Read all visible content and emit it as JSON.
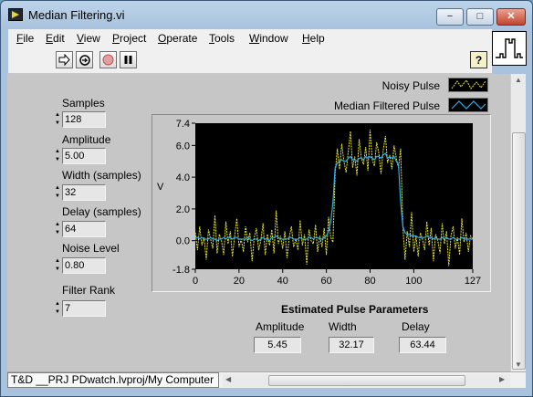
{
  "window": {
    "title": "Median Filtering.vi",
    "buttons": [
      "−",
      "□",
      "✕"
    ]
  },
  "menu": [
    {
      "label": "File",
      "key": "F",
      "rest": "ile"
    },
    {
      "label": "Edit",
      "key": "E",
      "rest": "dit"
    },
    {
      "label": "View",
      "key": "V",
      "rest": "iew"
    },
    {
      "label": "Project",
      "key": "P",
      "rest": "roject"
    },
    {
      "label": "Operate",
      "key": "O",
      "rest": "perate"
    },
    {
      "label": "Tools",
      "key": "T",
      "rest": "ools"
    },
    {
      "label": "Window",
      "key": "W",
      "rest": "indow"
    },
    {
      "label": "Help",
      "key": "H",
      "rest": "elp"
    }
  ],
  "toolbar": {
    "run_icon": "run-arrow-icon",
    "run_continuous_icon": "run-continuously-icon",
    "abort_icon": "abort-stop-icon",
    "pause_icon": "pause-icon",
    "help_label": "?"
  },
  "controls": {
    "samples": {
      "label": "Samples",
      "value": "128"
    },
    "amplitude": {
      "label": "Amplitude",
      "value": "5.00"
    },
    "width": {
      "label": "Width (samples)",
      "value": "32"
    },
    "delay": {
      "label": "Delay (samples)",
      "value": "64"
    },
    "noise": {
      "label": "Noise Level",
      "value": "0.80"
    },
    "rank": {
      "label": "Filter Rank",
      "value": "7"
    }
  },
  "legend": {
    "noisy": {
      "name": "Noisy Pulse",
      "color": "#e8e830"
    },
    "filtered": {
      "name": "Median Filtered Pulse",
      "color": "#2bb0e8"
    }
  },
  "estimated": {
    "title": "Estimated Pulse Parameters",
    "amplitude": {
      "label": "Amplitude",
      "value": "5.45"
    },
    "width": {
      "label": "Width",
      "value": "32.17"
    },
    "delay": {
      "label": "Delay",
      "value": "63.44"
    }
  },
  "status": {
    "project_path": "T&D __PRJ PDwatch.lvproj/My Computer"
  },
  "chart_data": {
    "type": "line",
    "title": "",
    "xlabel": "",
    "ylabel": "V",
    "xlim": [
      0,
      127
    ],
    "ylim": [
      -1.8,
      7.4
    ],
    "x_ticks": [
      0,
      20,
      40,
      60,
      80,
      100,
      127
    ],
    "y_ticks": [
      -1.8,
      0.0,
      2.0,
      4.0,
      6.0,
      7.4
    ],
    "y_tick_labels": [
      "-1.8",
      "0.0",
      "2.0",
      "4.0",
      "6.0",
      "7.4"
    ],
    "background": "#000000",
    "series": [
      {
        "name": "Noisy Pulse",
        "color": "#e8e830",
        "values": [
          0.5,
          -0.6,
          0.9,
          -0.3,
          0.2,
          -1.2,
          0.7,
          0.1,
          -0.5,
          1.6,
          -0.8,
          0.4,
          0.0,
          -0.9,
          1.2,
          -0.2,
          0.6,
          -1.0,
          0.3,
          1.4,
          -0.4,
          0.1,
          -0.7,
          0.9,
          -0.1,
          0.5,
          -1.3,
          0.2,
          0.8,
          -0.6,
          0.0,
          1.1,
          -0.9,
          0.4,
          -0.3,
          0.7,
          -0.8,
          1.9,
          -0.2,
          0.3,
          -0.5,
          0.6,
          -1.1,
          0.2,
          0.9,
          -0.4,
          0.1,
          -0.6,
          1.3,
          -0.3,
          0.4,
          -1.5,
          0.7,
          0.0,
          -0.2,
          1.0,
          -0.7,
          0.3,
          -0.4,
          0.8,
          -0.9,
          1.5,
          0.2,
          -0.1,
          4.2,
          5.8,
          4.5,
          6.1,
          5.0,
          4.3,
          5.6,
          6.9,
          4.6,
          5.3,
          4.1,
          6.4,
          5.2,
          4.8,
          5.9,
          4.4,
          7.0,
          5.1,
          4.7,
          6.2,
          5.5,
          4.2,
          5.7,
          6.6,
          4.9,
          5.4,
          4.5,
          6.0,
          5.2,
          4.6,
          5.8,
          0.9,
          -1.2,
          0.6,
          -0.4,
          1.8,
          -0.7,
          0.3,
          -1.0,
          0.5,
          0.1,
          -0.6,
          1.2,
          -0.3,
          0.8,
          -1.3,
          0.4,
          0.0,
          -0.8,
          1.1,
          -0.2,
          0.6,
          -1.6,
          0.3,
          0.9,
          -0.5,
          0.2,
          -0.9,
          1.4,
          -0.1,
          0.5,
          -0.7,
          0.3,
          0.1
        ]
      },
      {
        "name": "Median Filtered Pulse",
        "color": "#2bb0e8",
        "values": [
          0.2,
          0.2,
          0.1,
          0.2,
          0.1,
          0.1,
          0.1,
          0.2,
          0.1,
          0.1,
          0.0,
          0.1,
          0.1,
          0.2,
          0.1,
          0.2,
          0.2,
          0.1,
          0.2,
          0.2,
          0.1,
          0.1,
          0.1,
          0.1,
          0.2,
          0.1,
          0.0,
          0.1,
          0.1,
          0.0,
          0.1,
          0.2,
          0.1,
          0.1,
          0.0,
          0.2,
          0.2,
          0.3,
          0.2,
          0.1,
          0.1,
          0.1,
          0.1,
          0.2,
          0.2,
          0.1,
          0.1,
          0.1,
          0.2,
          0.1,
          0.1,
          0.1,
          0.2,
          0.2,
          0.1,
          0.2,
          0.2,
          0.1,
          0.1,
          0.2,
          0.3,
          0.6,
          1.2,
          2.4,
          4.6,
          4.9,
          5.0,
          5.1,
          5.0,
          5.0,
          5.2,
          5.3,
          5.1,
          5.1,
          5.0,
          5.2,
          5.2,
          5.1,
          5.3,
          5.2,
          5.3,
          5.2,
          5.1,
          5.3,
          5.3,
          5.2,
          5.4,
          5.5,
          5.2,
          5.3,
          5.2,
          5.3,
          5.0,
          4.8,
          2.4,
          0.9,
          0.5,
          0.4,
          0.4,
          0.3,
          0.3,
          0.3,
          0.2,
          0.2,
          0.2,
          0.2,
          0.3,
          0.2,
          0.2,
          0.1,
          0.2,
          0.1,
          0.1,
          0.2,
          0.1,
          0.2,
          0.1,
          0.1,
          0.2,
          0.1,
          0.1,
          0.1,
          0.2,
          0.1,
          0.1,
          0.1,
          0.1,
          0.1
        ]
      }
    ]
  }
}
